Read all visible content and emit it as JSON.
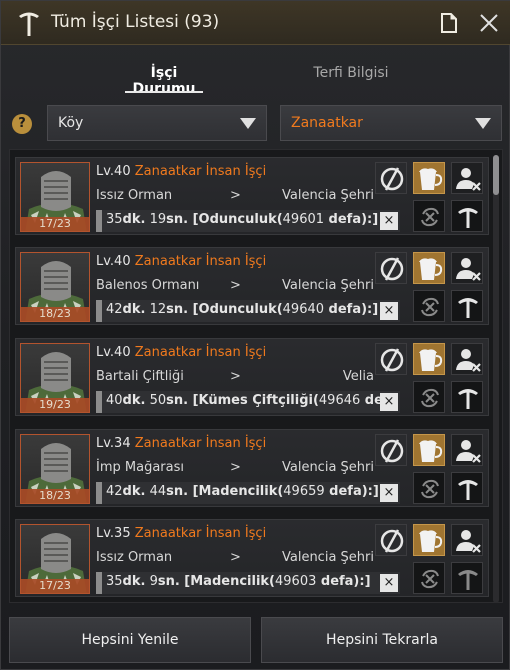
{
  "window": {
    "title": "Tüm İşçi Listesi (93)",
    "icons": {
      "title": "pickaxe-icon",
      "doc": "document-icon",
      "close": "close-icon"
    }
  },
  "tabs": [
    {
      "label": "İşçi Durumu",
      "active": true
    },
    {
      "label": "Terfi Bilgisi",
      "active": false
    }
  ],
  "filters": {
    "help": "?",
    "village": "Köy",
    "worker_type": "Zanaatkar"
  },
  "workers": [
    {
      "level": "Lv.40",
      "type": "Zanaatkar İnsan İşçi",
      "from": "Issız Orman",
      "arrow": ">",
      "to": "Valencia Şehri",
      "stamina": "17/23",
      "task_time_a": "35",
      "task_unit_a": "dk.",
      "task_time_b": " 19",
      "task_unit_b": "sn.",
      "task_job": " [Odunculuk(",
      "task_count": "49601",
      "task_tail": " defa):]",
      "task_close": "×"
    },
    {
      "level": "Lv.40",
      "type": "Zanaatkar İnsan İşçi",
      "from": "Balenos Ormanı",
      "arrow": ">",
      "to": "Valencia Şehri",
      "stamina": "18/23",
      "task_time_a": "42",
      "task_unit_a": "dk.",
      "task_time_b": " 12",
      "task_unit_b": "sn.",
      "task_job": " [Odunculuk(",
      "task_count": "49640",
      "task_tail": " defa):]",
      "task_close": "×"
    },
    {
      "level": "Lv.40",
      "type": "Zanaatkar İnsan İşçi",
      "from": "Bartali Çiftliği",
      "arrow": ">",
      "to": "Velia",
      "stamina": "19/23",
      "task_time_a": "40",
      "task_unit_a": "dk.",
      "task_time_b": " 50",
      "task_unit_b": "sn.",
      "task_job": " [Kümes Çiftçiliği(",
      "task_count": "49646",
      "task_tail": " defa",
      "task_close": "×"
    },
    {
      "level": "Lv.34",
      "type": "Zanaatkar İnsan İşçi",
      "from": "İmp Mağarası",
      "arrow": ">",
      "to": "Valencia Şehri",
      "stamina": "18/23",
      "task_time_a": "42",
      "task_unit_a": "dk.",
      "task_time_b": " 44",
      "task_unit_b": "sn.",
      "task_job": " [Madencilik(",
      "task_count": "49659",
      "task_tail": " defa):]",
      "task_close": "×"
    },
    {
      "level": "Lv.35",
      "type": "Zanaatkar İnsan İşçi",
      "from": "Issız Orman",
      "arrow": ">",
      "to": "Valencia Şehri",
      "stamina": "17/23",
      "task_time_a": "35",
      "task_unit_a": "dk.",
      "task_time_b": " 9",
      "task_unit_b": "sn.",
      "task_job": " [Madencilik(",
      "task_count": "49603",
      "task_tail": " defa):]",
      "task_close": "×"
    }
  ],
  "card_icons": [
    "rest-icon",
    "beer-cup-icon",
    "fire-worker-icon",
    "repeat-icon",
    "pickaxe-icon"
  ],
  "buttons": {
    "refresh_all": "Hepsini Yenile",
    "repeat_all": "Hepsini Tekrarla"
  },
  "colors": {
    "accent_orange": "#f07a1e",
    "gold": "#a07531",
    "title_bar": "#3e3626"
  }
}
